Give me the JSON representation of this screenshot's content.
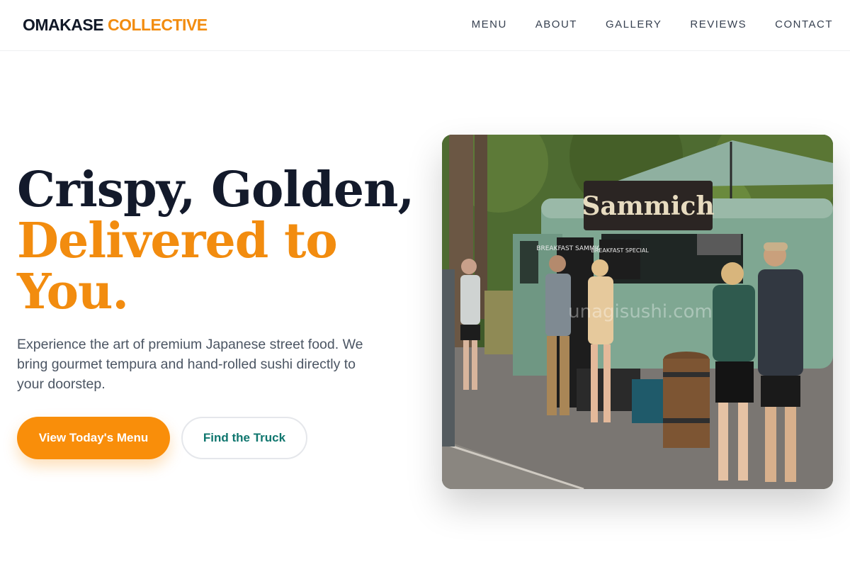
{
  "header": {
    "logo_main": "OMAKASE",
    "logo_accent": "COLLECTIVE",
    "nav": [
      "MENU",
      "ABOUT",
      "GALLERY",
      "REVIEWS",
      "CONTACT"
    ]
  },
  "hero": {
    "title_line1": "Crispy, Golden,",
    "title_line2": "Delivered to You.",
    "description": "Experience the art of premium Japanese street food. We bring gourmet tempura and hand-rolled sushi directly to your doorstep.",
    "primary_button": "View Today's Menu",
    "secondary_button": "Find the Truck",
    "image_sign_text": "Sammich",
    "image_menu_board_1": "BREAKFAST SAMMICHES",
    "image_menu_board_2": "BREAKFAST SPECIAL",
    "image_watermark": "unagisushi.com"
  },
  "colors": {
    "accent": "#f28c0f",
    "primary_button": "#f98e0a",
    "secondary_text": "#0f766e",
    "heading": "#131a2b"
  }
}
